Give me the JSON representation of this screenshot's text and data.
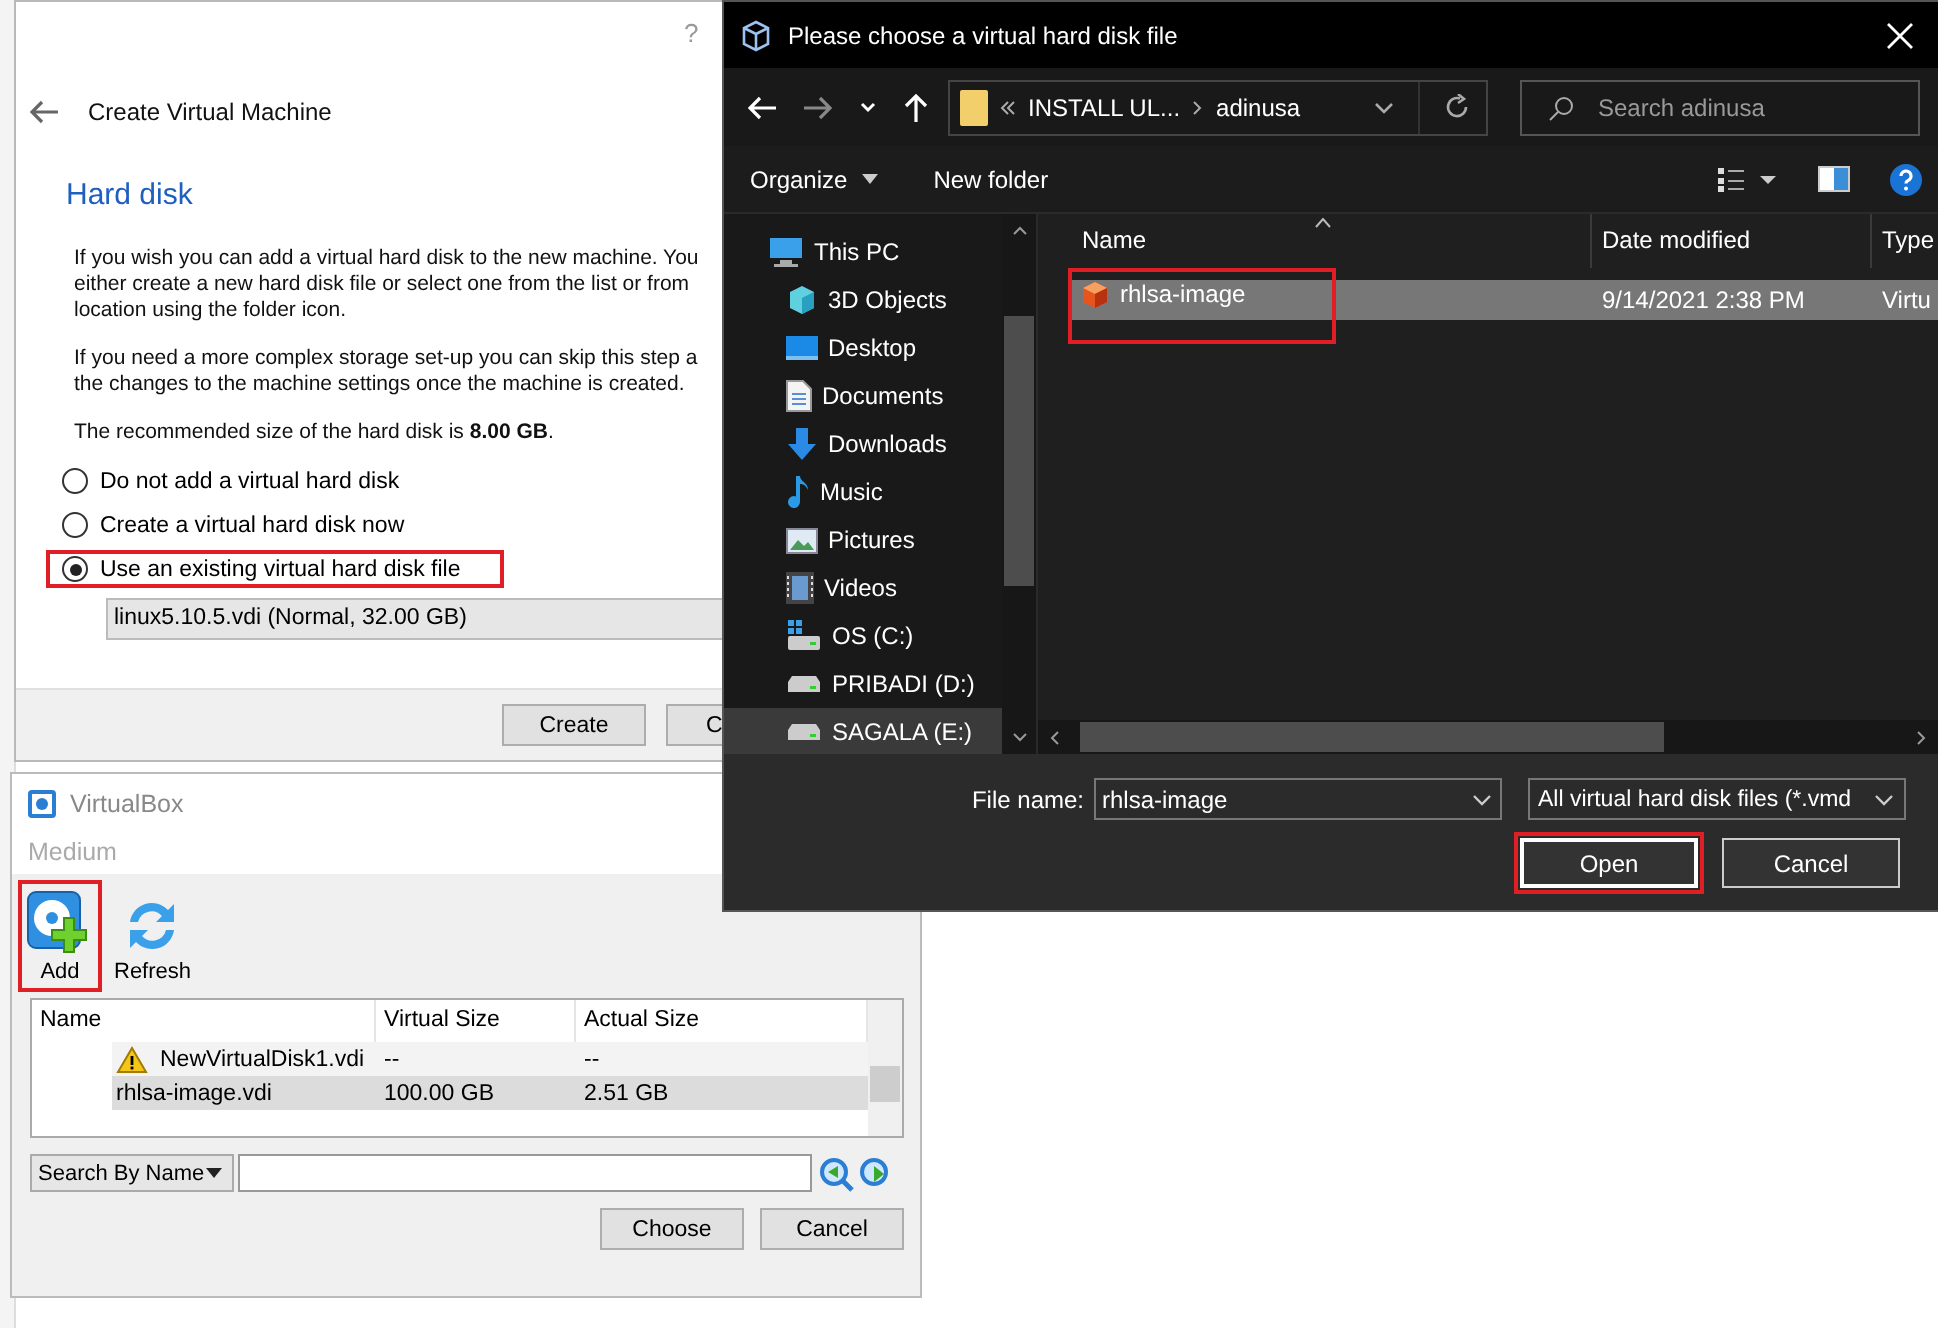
{
  "create_vm": {
    "help": "?",
    "title": "Create Virtual Machine",
    "heading": "Hard disk",
    "paragraphs": [
      [
        "If you wish you can add a virtual hard disk to the new machine. You",
        "either create a new hard disk file or select one from the list or from",
        "location using the folder icon."
      ],
      [
        "If you need a more complex storage set-up you can skip this step a",
        "the changes to the machine settings once the machine is created."
      ],
      [
        "The recommended size of the hard disk is **8.00 GB**."
      ]
    ],
    "options": [
      {
        "label": "Do not add a virtual hard disk",
        "selected": false,
        "highlighted": false
      },
      {
        "label": "Create a virtual hard disk now",
        "selected": false,
        "highlighted": false
      },
      {
        "label": "Use an existing virtual hard disk file",
        "selected": true,
        "highlighted": true
      }
    ],
    "disk_select": "linux5.10.5.vdi (Normal, 32.00 GB)",
    "buttons": [
      "Create",
      "C"
    ]
  },
  "medium_dialog": {
    "title": "VirtualBox",
    "header": "Medium",
    "toolbar": [
      {
        "kind": "add",
        "label": "Add",
        "highlighted": true
      },
      {
        "kind": "refresh",
        "label": "Refresh",
        "highlighted": false
      }
    ],
    "columns": [
      "Name",
      "Virtual Size",
      "Actual Size"
    ],
    "rows": [
      {
        "name": "NewVirtualDisk1.vdi",
        "virtual_size": "--",
        "actual_size": "--",
        "warning": true,
        "selected": false
      },
      {
        "name": "rhlsa-image.vdi",
        "virtual_size": "100.00 GB",
        "actual_size": "2.51 GB",
        "warning": false,
        "selected": true
      }
    ],
    "search_mode": "Search By Name",
    "buttons": [
      "Choose",
      "Cancel"
    ]
  },
  "file_dialog": {
    "title": "Please choose a virtual hard disk file",
    "breadcrumb": [
      "INSTALL UL...",
      "adinusa"
    ],
    "search": {
      "placeholder": "Search adinusa"
    },
    "commands": [
      "Organize",
      "New folder"
    ],
    "sidebar": [
      {
        "label": "This PC",
        "kind": "pc",
        "selected": false,
        "children": [
          {
            "label": "3D Objects",
            "kind": "objects",
            "selected": false
          },
          {
            "label": "Desktop",
            "kind": "desktop",
            "selected": false
          },
          {
            "label": "Documents",
            "kind": "documents",
            "selected": false
          },
          {
            "label": "Downloads",
            "kind": "downloads",
            "selected": false
          },
          {
            "label": "Music",
            "kind": "music",
            "selected": false
          },
          {
            "label": "Pictures",
            "kind": "pictures",
            "selected": false
          },
          {
            "label": "Videos",
            "kind": "videos",
            "selected": false
          },
          {
            "label": "OS (C:)",
            "kind": "system-drive",
            "selected": false
          },
          {
            "label": "PRIBADI (D:)",
            "kind": "drive",
            "selected": false
          },
          {
            "label": "SAGALA (E:)",
            "kind": "drive",
            "selected": true
          }
        ]
      }
    ],
    "columns": [
      "Name",
      "Date modified",
      "Type"
    ],
    "files": [
      {
        "name": "rhlsa-image",
        "date": "9/14/2021 2:38 PM",
        "type": "Virtu",
        "selected": true,
        "highlighted": true
      }
    ],
    "file_name_label": "File name:",
    "file_name": "rhlsa-image",
    "filter": "All virtual hard disk files (*.vmd",
    "buttons": [
      {
        "label": "Open",
        "highlighted": true
      },
      {
        "label": "Cancel",
        "highlighted": false
      }
    ]
  }
}
